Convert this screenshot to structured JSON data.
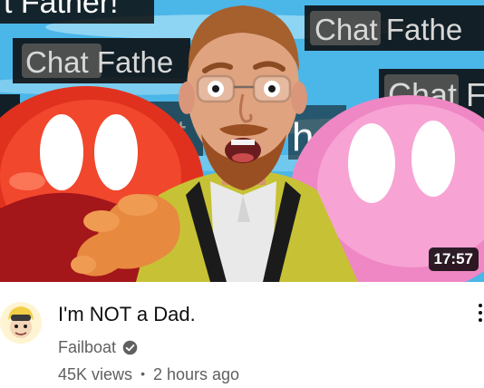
{
  "video": {
    "title": "I'm NOT a Dad.",
    "duration": "17:57",
    "channel": "Failboat",
    "views": "45K views",
    "separator": "•",
    "uploaded": "2 hours ago"
  },
  "thumbnail": {
    "overlay_texts": [
      "t Father!",
      "Chat Fathe",
      "Chat Fathe",
      "Chat F",
      "r!",
      "at",
      "he"
    ]
  },
  "icons": {
    "verified": "verified-check-icon",
    "more": "more-vert-icon"
  },
  "colors": {
    "title": "#0f0f0f",
    "secondary": "#606060",
    "duration_bg": "#000000"
  }
}
